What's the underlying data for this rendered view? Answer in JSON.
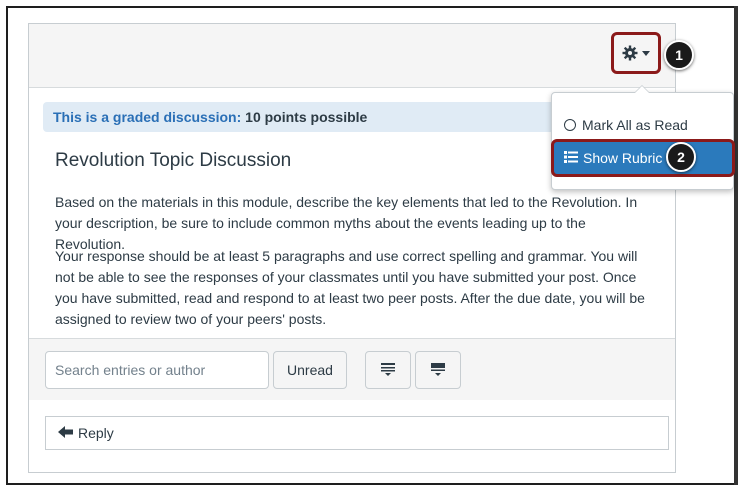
{
  "graded": {
    "label": "This is a graded discussion:",
    "points": "10 points possible"
  },
  "discussion": {
    "title": "Revolution Topic Discussion",
    "paragraph1": "Based on the materials in this module, describe the key elements that led to the Revolution. In your description, be sure to include common myths about the events leading up to the Revolution.",
    "paragraph2": "Your response should be at least 5 paragraphs and use correct spelling and grammar. You will not be able to see the responses of your classmates until you have submitted your post. Once you have submitted, read and respond to at least two peer posts. After the due date, you will be assigned to review two of your peers' posts."
  },
  "settings_menu": {
    "icon": "gear-icon",
    "items": [
      {
        "label": "Mark All as Read",
        "icon": "circle-icon"
      },
      {
        "label": "Show Rubric",
        "icon": "rubric-list-icon",
        "highlighted": true
      }
    ]
  },
  "step_badges": [
    "1",
    "2"
  ],
  "toolbar": {
    "search_placeholder": "Search entries or author",
    "unread_label": "Unread",
    "collapse_icon": "collapse-threads-icon",
    "expand_icon": "expand-threads-icon"
  },
  "reply": {
    "label": "Reply",
    "icon": "arrow-left-icon"
  },
  "colors": {
    "accent": "#2b7abc",
    "callout_border": "#8b1a1a",
    "graded_bg": "#e0ebf5",
    "graded_label": "#2a6fb6"
  }
}
